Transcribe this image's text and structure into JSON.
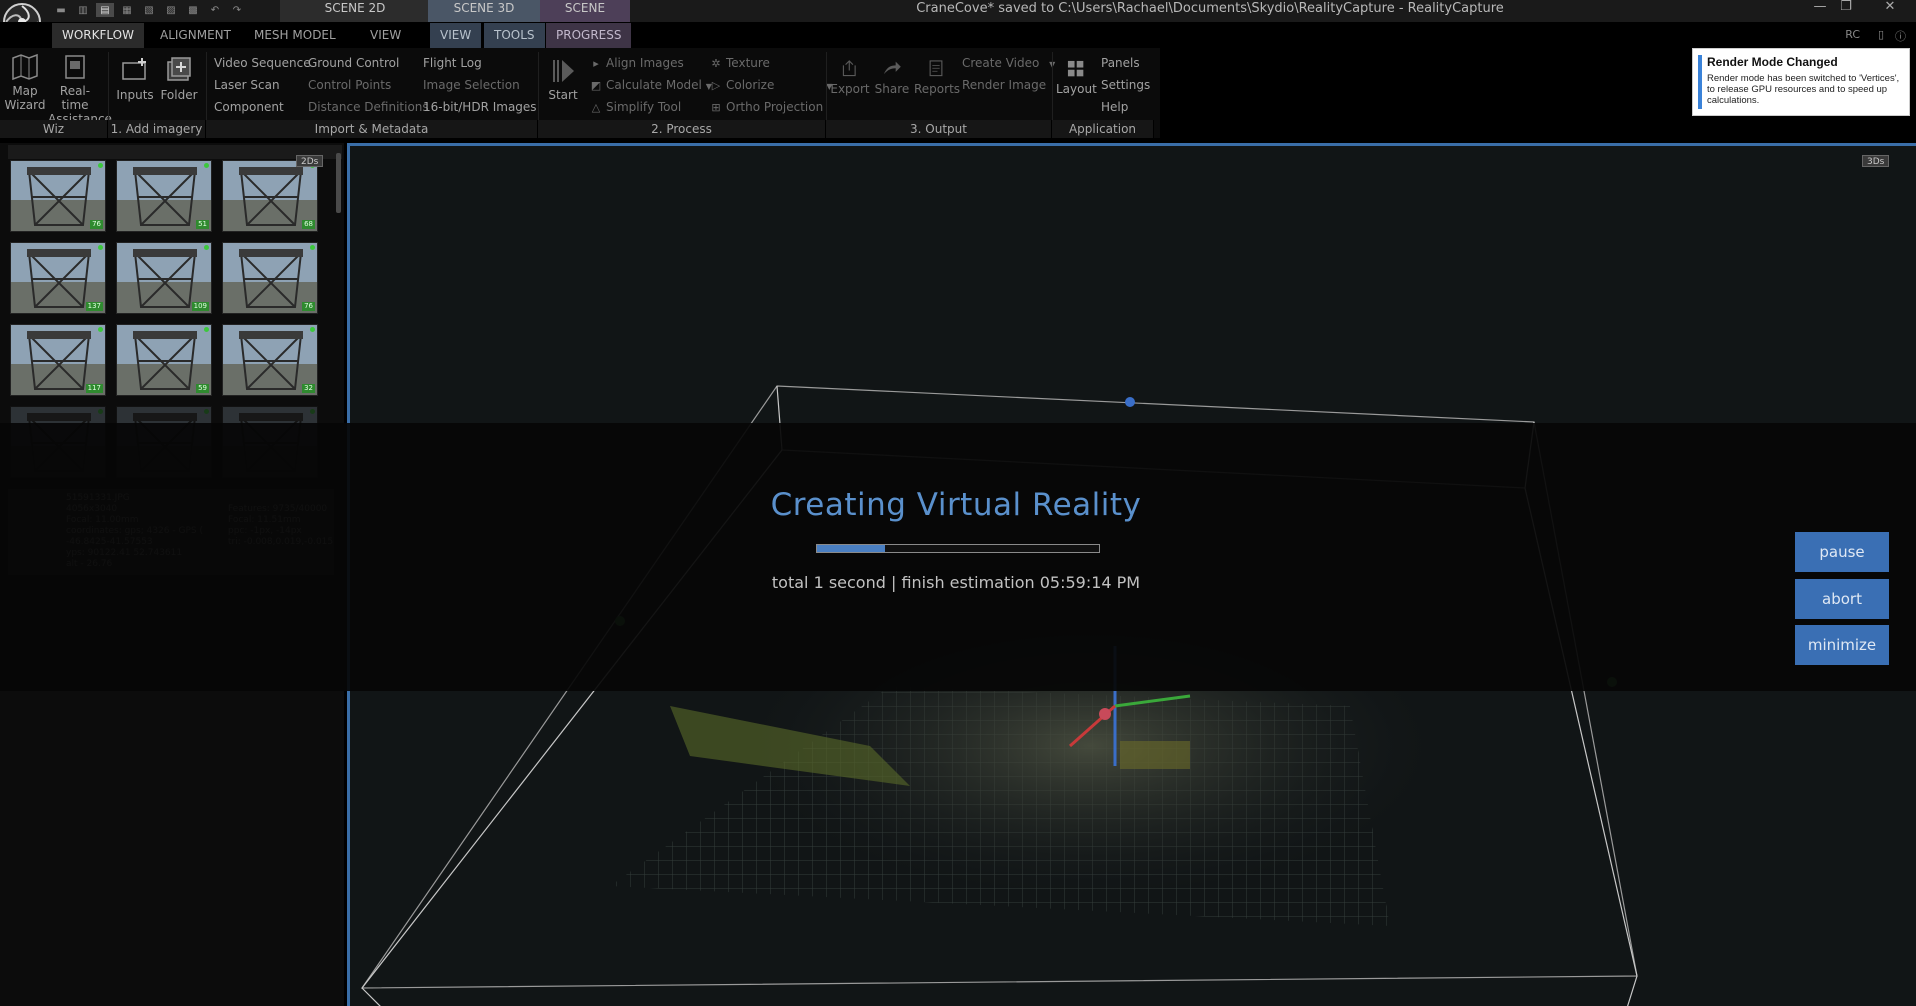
{
  "titlebar": {
    "window_title": "CraneCove* saved to C:\\Users\\Rachael\\Documents\\Skydio\\RealityCapture - RealityCapture",
    "context_tabs": [
      "SCENE 2D",
      "SCENE 3D",
      "SCENE"
    ],
    "min_glyph": "—",
    "max_glyph": "❐",
    "close_glyph": "✕"
  },
  "tabs": {
    "workflow": "WORKFLOW",
    "alignment": "ALIGNMENT",
    "mesh_model": "MESH MODEL",
    "view": "VIEW",
    "view_ctx": "VIEW",
    "tools": "TOOLS",
    "progress": "PROGRESS",
    "rc": "RC"
  },
  "ribbon": {
    "map_wizard": "Map Wizard",
    "realtime_assist": "Real-time Assistance",
    "inputs": "Inputs",
    "folder": "Folder",
    "import_col1": [
      "Video Sequence",
      "Laser Scan",
      "Component"
    ],
    "import_col2": [
      "Ground Control",
      "Control Points",
      "Distance Definitions"
    ],
    "import_col3": [
      "Flight Log",
      "Image Selection",
      "16-bit/HDR Images"
    ],
    "start": "Start",
    "process_col1": [
      "Align Images",
      "Calculate Model",
      "Simplify Tool"
    ],
    "process_col2": [
      "Texture",
      "Colorize",
      "Ortho Projection"
    ],
    "export": "Export",
    "share": "Share",
    "reports": "Reports",
    "create_video": "Create Video",
    "render_image": "Render Image",
    "layout": "Layout",
    "app_col": [
      "Panels",
      "Settings",
      "Help"
    ],
    "sections": {
      "wiz": "Wiz",
      "add_imagery": "1. Add imagery",
      "import_metadata": "Import & Metadata",
      "process": "2. Process",
      "output": "3. Output",
      "application": "Application"
    }
  },
  "notification": {
    "title": "Render Mode Changed",
    "body": "Render mode has been switched to 'Vertices', to release GPU resources and to speed up calculations."
  },
  "left_panel": {
    "badge": "2Ds",
    "thumb_tags": [
      "76",
      "51",
      "68",
      "137",
      "109",
      "76",
      "117",
      "59",
      "32",
      "",
      "",
      ""
    ],
    "info_card": {
      "left": [
        "51591331.JPG",
        "4056x3040",
        "Focal: 11.00mm",
        "coordinates: gps; 4326 - GPS (",
        "-46.8425-41.57553",
        "yps: 90122.41 52.743611",
        "alt - 26.76"
      ],
      "right": [
        "Features: 9735/40000",
        "Focal: 11.51mm",
        "ppc: -1px, -14px",
        "tri: -0.008,0.019,-0.015"
      ]
    }
  },
  "viewport": {
    "badge": "3Ds"
  },
  "progress_overlay": {
    "title": "Creating Virtual Reality",
    "progress": 0.24,
    "status": "total 1 second | finish estimation 05:59:14 PM",
    "pause": "pause",
    "abort": "abort",
    "minimize": "minimize"
  },
  "colors": {
    "accent": "#4a7fc2",
    "title_blue": "#5a90cc",
    "notify_bar": "#3a82d8",
    "thumb_ok": "#2f8a2f"
  }
}
